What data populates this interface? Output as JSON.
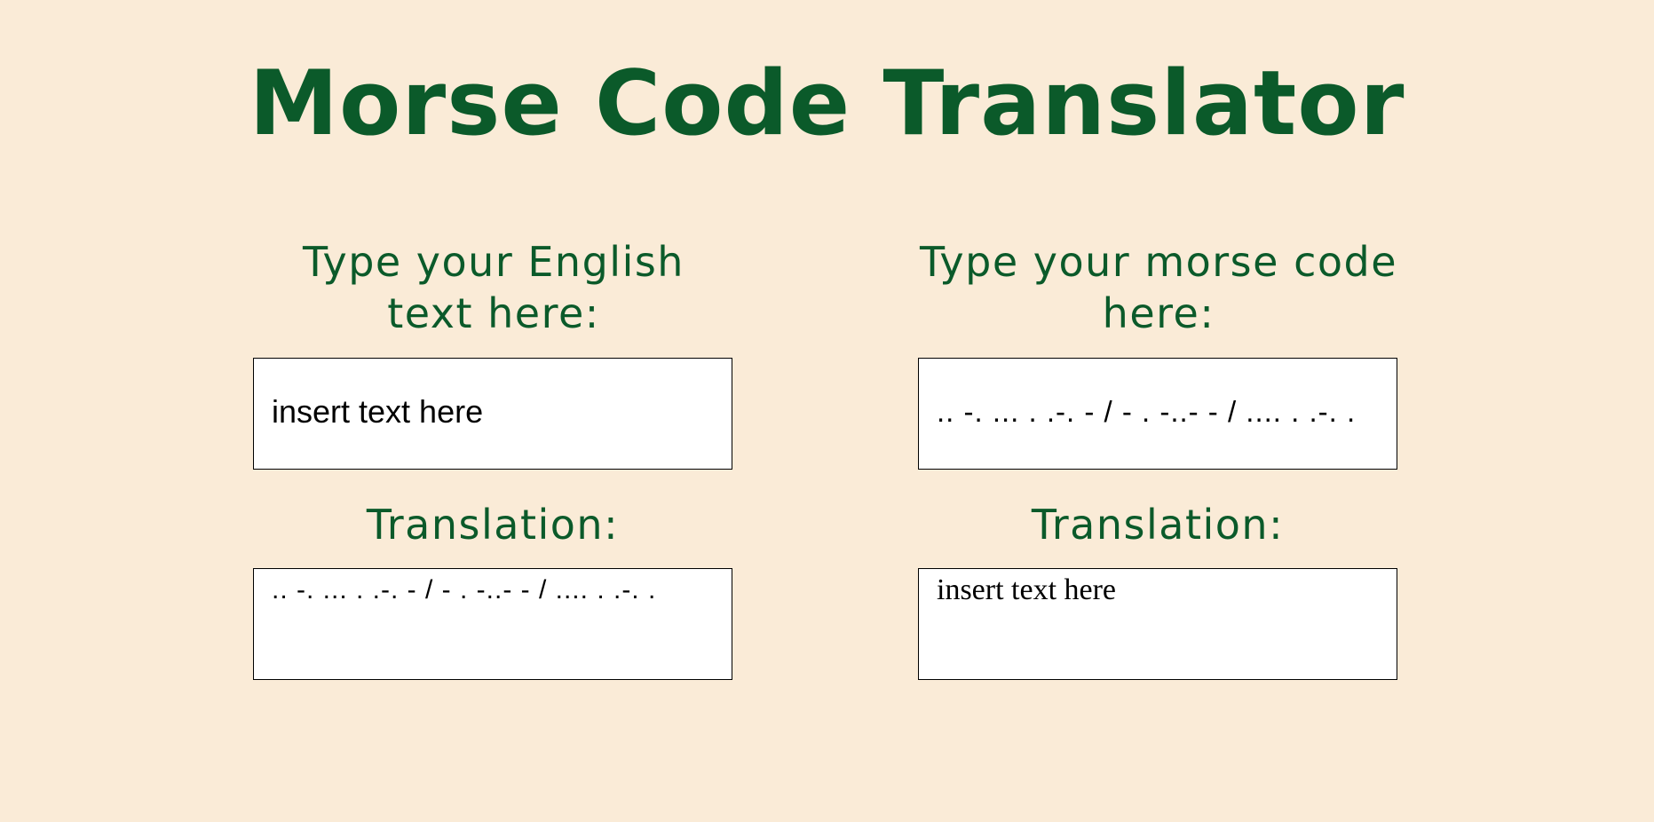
{
  "title": "Morse Code Translator",
  "english_panel": {
    "prompt": "Type your English text here:",
    "input_value": "insert text here",
    "translation_label": "Translation:",
    "translation_value": ".. -. ... . .-. - / - . -..- - / .... . .-. ."
  },
  "morse_panel": {
    "prompt": "Type your morse code here:",
    "input_value": ".. -. ... . .-. - / - . -..- - / .... . .-. .",
    "translation_label": "Translation:",
    "translation_value": "insert text here"
  },
  "colors": {
    "background": "#faebd7",
    "heading": "#0b5a2a",
    "box_background": "#ffffff",
    "box_border": "#000000"
  }
}
